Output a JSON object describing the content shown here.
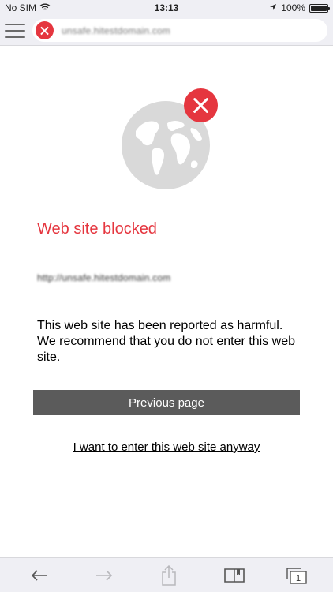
{
  "status_bar": {
    "carrier": "No SIM",
    "time": "13:13",
    "battery": "100%",
    "battery_level": 1.0
  },
  "toolbar": {
    "url": "unsafe.hitestdomain.com",
    "address_icon": "blocked-x-icon",
    "menu_icon": "hamburger-menu-icon"
  },
  "main": {
    "illustration_icon": "globe-icon",
    "badge_icon": "blocked-x-icon",
    "title": "Web site blocked",
    "blocked_url": "http://unsafe.hitestdomain.com",
    "message": "This web site has been reported as harmful. We recommend that you do not enter this web site.",
    "previous_button": "Previous page",
    "enter_link": "I want to enter this web site anyway"
  },
  "bottom_bar": {
    "back_icon": "arrow-left-icon",
    "forward_icon": "arrow-right-icon",
    "share_icon": "share-icon",
    "bookmarks_icon": "book-icon",
    "tabs_icon": "tabs-icon",
    "tab_count": "1"
  },
  "colors": {
    "accent_red": "#e5363f",
    "button_gray": "#5b5b5b",
    "bar_background": "#efeff4",
    "globe_gray": "#d9d9d9"
  }
}
